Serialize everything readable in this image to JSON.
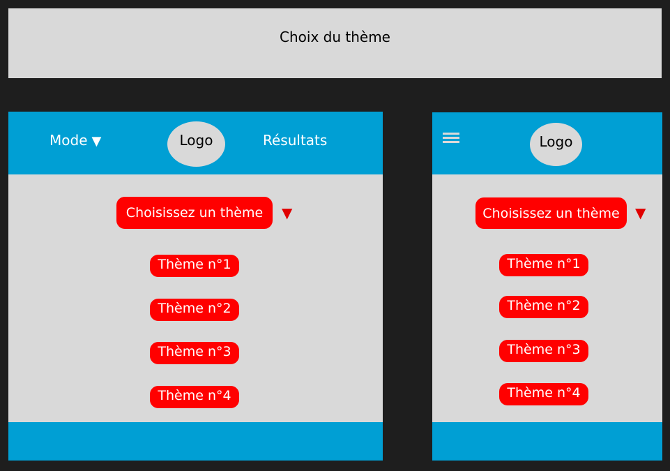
{
  "page_title": "Choix du thème",
  "desktop": {
    "nav": {
      "mode_label": "Mode",
      "mode_caret": "▼",
      "logo": "Logo",
      "results_label": "Résultats"
    },
    "dropdown_label": "Choisissez un thème",
    "dropdown_caret": "▼",
    "themes": [
      "Thème n°1",
      "Thème n°2",
      "Thème n°3",
      "Thème n°4"
    ]
  },
  "mobile": {
    "nav": {
      "logo": "Logo"
    },
    "dropdown_label": "Choisissez un thème",
    "dropdown_caret": "▼",
    "themes": [
      "Thème n°1",
      "Thème n°2",
      "Thème n°3",
      "Thème n°4"
    ]
  },
  "colors": {
    "background": "#1e1e1e",
    "panel": "#d9d9d9",
    "header": "#009fd4",
    "accent": "#ff0000",
    "caret": "#e00000"
  }
}
